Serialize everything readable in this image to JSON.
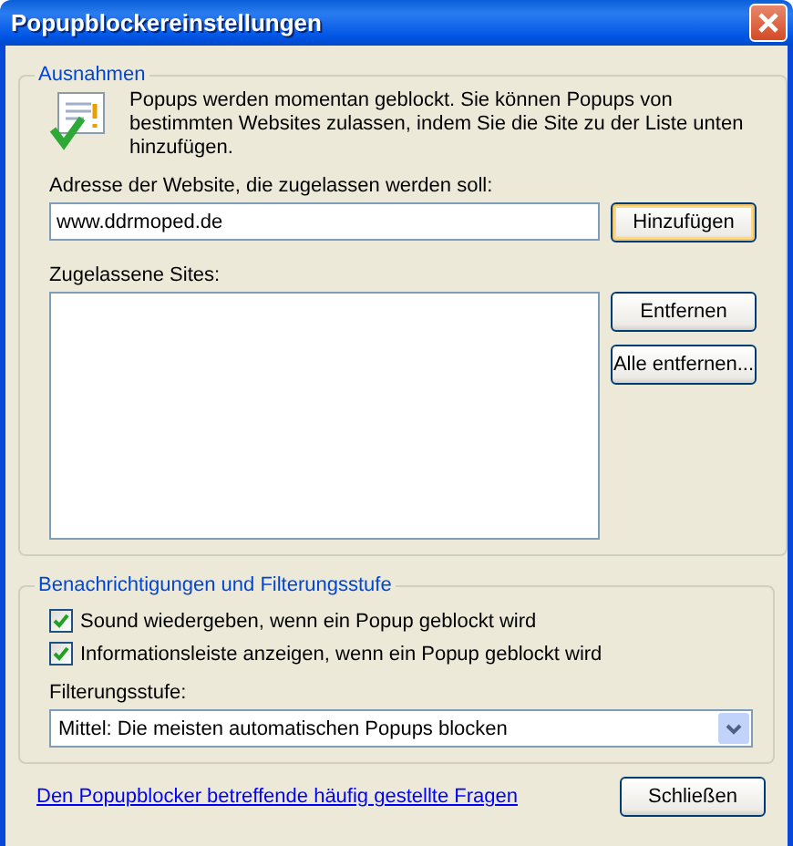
{
  "window": {
    "title": "Popupblockereinstellungen"
  },
  "exceptions": {
    "legend": "Ausnahmen",
    "description": "Popups werden momentan geblockt. Sie können Popups von bestimmten Websites zulassen, indem Sie die Site zu der Liste unten hinzufügen.",
    "address_label": "Adresse der Website, die zugelassen werden soll:",
    "address_value": "www.ddrmoped.de",
    "add_button": "Hinzufügen",
    "sites_label": "Zugelassene Sites:",
    "remove_button": "Entfernen",
    "remove_all_button": "Alle entfernen..."
  },
  "notifications": {
    "legend": "Benachrichtigungen und Filterungsstufe",
    "options": [
      {
        "label": "Sound wiedergeben, wenn ein Popup geblockt wird",
        "checked": true
      },
      {
        "label": "Informationsleiste anzeigen, wenn ein Popup geblockt wird",
        "checked": true
      }
    ],
    "filter_label": "Filterungsstufe:",
    "filter_value": "Mittel: Die meisten automatischen Popups blocken"
  },
  "faq_link": "Den Popupblocker betreffende häufig gestellte Fragen",
  "close_button": "Schließen"
}
